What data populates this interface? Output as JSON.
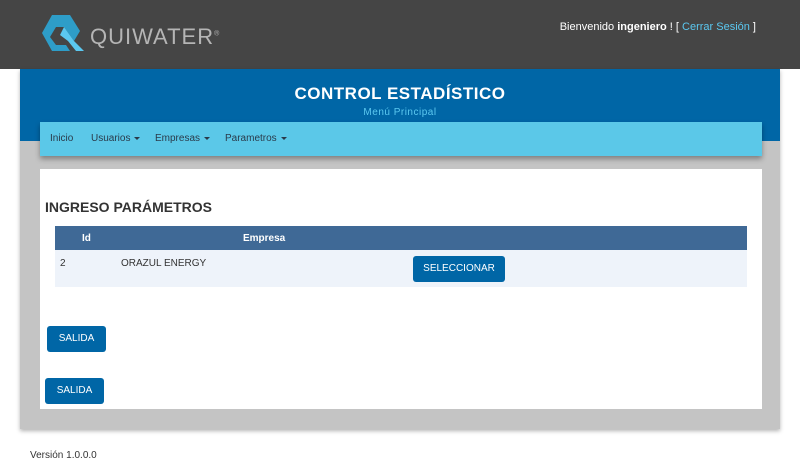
{
  "header": {
    "logo_text": "QUIWATER",
    "logo_mark": "®",
    "welcome_prefix": "Bienvenido ",
    "username": "ingeniero",
    "welcome_suffix": " ! [ ",
    "logout_link": "Cerrar Sesión",
    "welcome_end": " ]"
  },
  "banner": {
    "title": "CONTROL ESTADÍSTICO",
    "subtitle": "Menú Principal"
  },
  "nav": {
    "items": [
      {
        "label": "Inicio"
      },
      {
        "label": "Usuarios"
      },
      {
        "label": "Empresas"
      },
      {
        "label": "Parametros"
      }
    ]
  },
  "main": {
    "title": "INGRESO PARÁMETROS",
    "table": {
      "columns": [
        "Id",
        "Empresa"
      ],
      "rows": [
        {
          "id": "2",
          "empresa": "ORAZUL ENERGY",
          "action": "SELECCIONAR"
        }
      ]
    },
    "exit_button_1": "SALIDA",
    "exit_button_2": "SALIDA"
  },
  "footer": {
    "version": "Versión 1.0.0.0"
  },
  "colors": {
    "topbar": "#454545",
    "banner": "#0066a6",
    "navbar": "#5bc8e8",
    "table_header": "#3f6996",
    "button": "#0066a6"
  }
}
